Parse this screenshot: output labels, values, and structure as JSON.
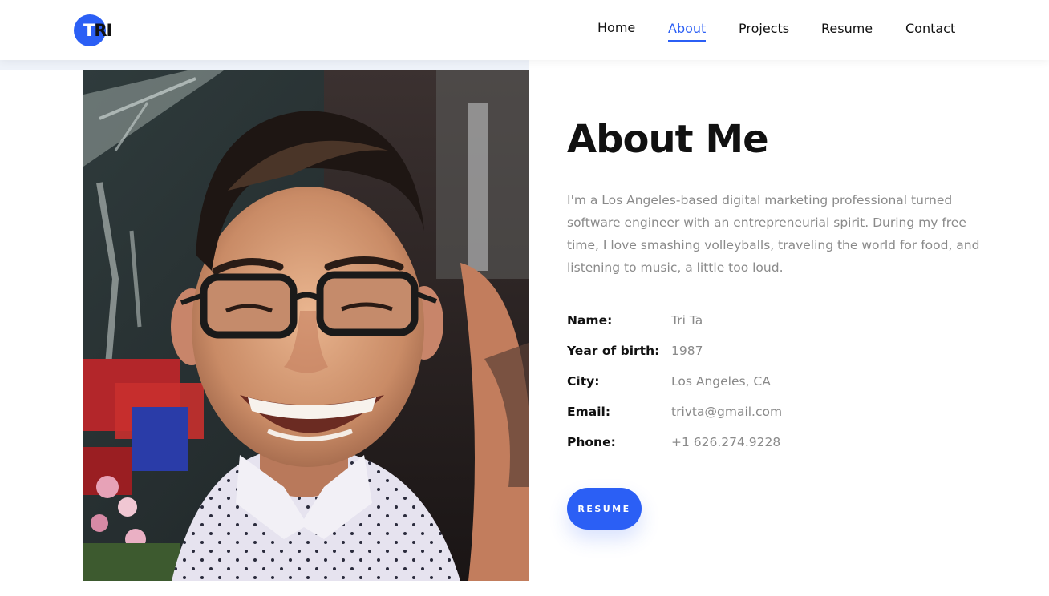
{
  "logo": {
    "text_white": "T",
    "text_dark": "RI"
  },
  "nav": {
    "items": [
      {
        "label": "Home",
        "active": false
      },
      {
        "label": "About",
        "active": true
      },
      {
        "label": "Projects",
        "active": false
      },
      {
        "label": "Resume",
        "active": false
      },
      {
        "label": "Contact",
        "active": false
      }
    ]
  },
  "colors": {
    "accent": "#2b5ff5",
    "title": "#111111",
    "muted_text": "#8a8a8a",
    "photo_backdrop": "#eef2f9"
  },
  "about": {
    "title": "About Me",
    "bio": "I'm a Los Angeles-based digital marketing professional turned software engineer with an entrepreneurial spirit. During my free time, I love smashing volleyballs, traveling the world for food, and listening to music, a little too loud.",
    "info": [
      {
        "label": "Name:",
        "value": "Tri Ta"
      },
      {
        "label": "Year of birth:",
        "value": "1987"
      },
      {
        "label": "City:",
        "value": "Los Angeles, CA"
      },
      {
        "label": "Email:",
        "value": "trivta@gmail.com"
      },
      {
        "label": "Phone:",
        "value": "+1 626.274.9228"
      }
    ],
    "resume_button": "RESUME"
  },
  "photo": {
    "subject": "portrait-photo"
  }
}
